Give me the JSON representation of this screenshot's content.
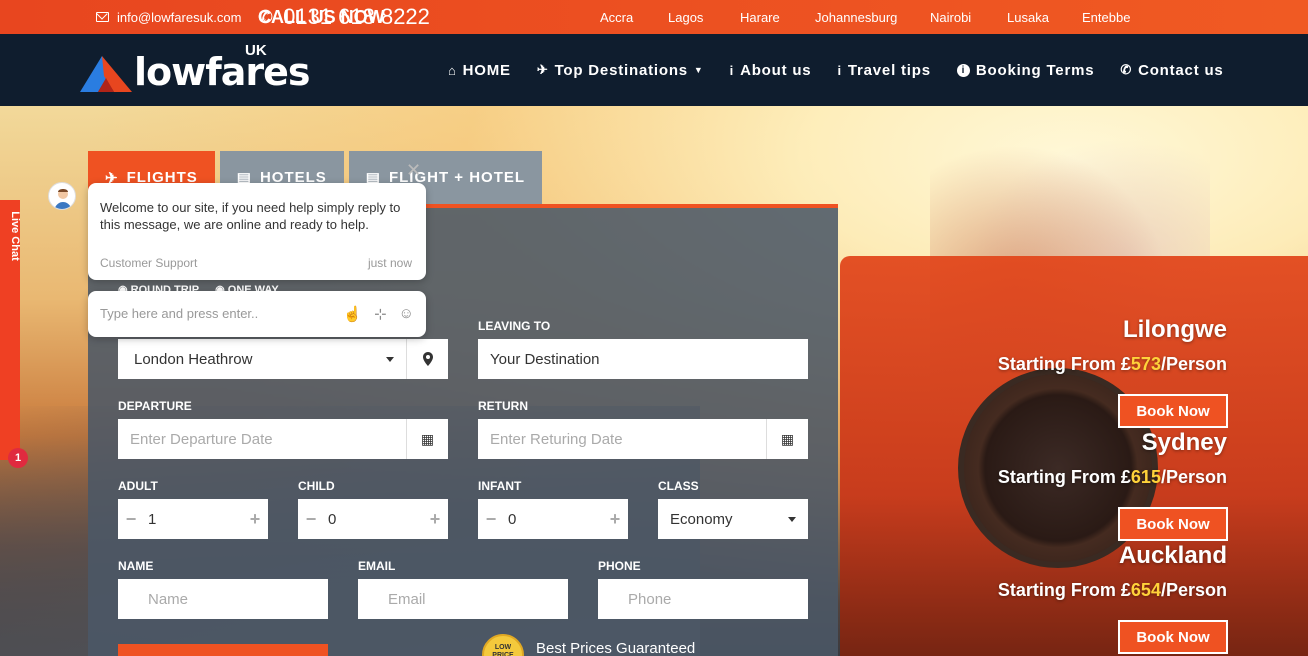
{
  "topbar": {
    "email": "info@lowfaresuk.com",
    "call_label": "CALL US NOW",
    "phone": "0131 618 8222",
    "cities": [
      "Accra",
      "Lagos",
      "Harare",
      "Johannesburg",
      "Nairobi",
      "Lusaka",
      "Entebbe"
    ]
  },
  "brand": {
    "name": "lowfares",
    "suffix": "UK"
  },
  "nav": [
    {
      "label": "HOME",
      "icon": "home-icon"
    },
    {
      "label": "Top Destinations",
      "icon": "plane-icon"
    },
    {
      "label": "About us",
      "icon": "info-icon"
    },
    {
      "label": "Travel tips",
      "icon": "info-icon"
    },
    {
      "label": "Booking Terms",
      "icon": "info-circle-icon"
    },
    {
      "label": "Contact us",
      "icon": "phone-icon"
    }
  ],
  "tabs": [
    {
      "label": "FLIGHTS",
      "active": true
    },
    {
      "label": "HOTELS",
      "active": false
    },
    {
      "label": "FLIGHT + HOTEL",
      "active": false
    }
  ],
  "trip_type": {
    "round": "ROUND TRIP",
    "oneway": "ONE WAY"
  },
  "form": {
    "leaving_to_label": "LEAVING TO",
    "from_value": "London Heathrow",
    "to_placeholder": "Your Destination",
    "departure_label": "DEPARTURE",
    "departure_placeholder": "Enter Departure Date",
    "return_label": "RETURN",
    "return_placeholder": "Enter Returing Date",
    "adult_label": "ADULT",
    "adult_value": "1",
    "child_label": "CHILD",
    "child_value": "0",
    "infant_label": "INFANT",
    "infant_value": "0",
    "class_label": "CLASS",
    "class_value": "Economy",
    "name_label": "NAME",
    "name_placeholder": "Name",
    "email_label": "EMAIL",
    "email_placeholder": "Email",
    "phone_label": "PHONE",
    "phone_placeholder": "Phone"
  },
  "guarantee": {
    "seal": "LOW PRICE",
    "text": "Best Prices Guaranteed"
  },
  "chat": {
    "side_label": "Live Chat",
    "badge": "1",
    "message": "Welcome to our site, if you need help simply reply to this message, we are online and ready to help.",
    "from": "Customer Support",
    "time": "just now",
    "input_placeholder": "Type here and press enter.."
  },
  "destinations": [
    {
      "city": "Lilongwe",
      "prefix": "Starting From £",
      "amount": "573",
      "suffix": "/Person",
      "cta": "Book Now"
    },
    {
      "city": "Sydney",
      "prefix": "Starting From £",
      "amount": "615",
      "suffix": "/Person",
      "cta": "Book Now"
    },
    {
      "city": "Auckland",
      "prefix": "Starting From £",
      "amount": "654",
      "suffix": "/Person",
      "cta": "Book Now"
    }
  ]
}
